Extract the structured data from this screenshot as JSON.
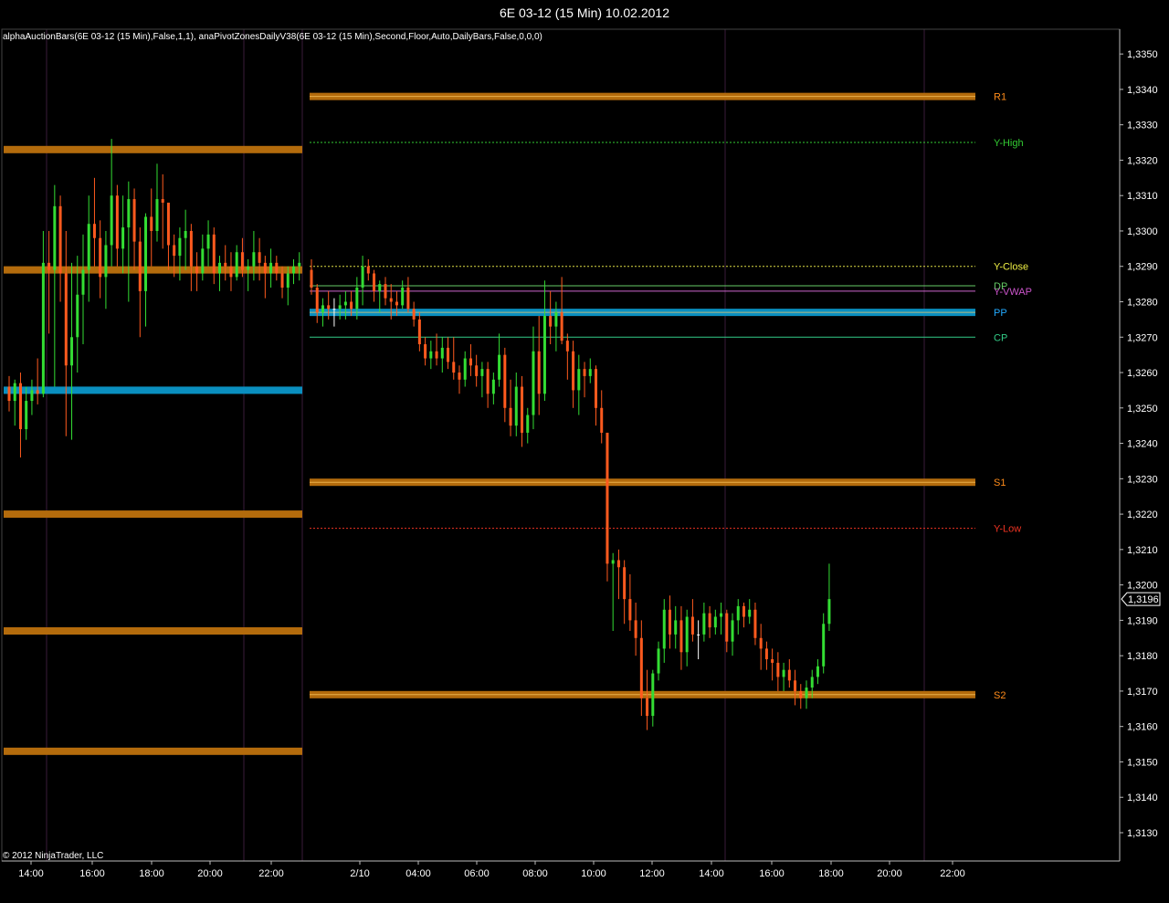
{
  "window": {
    "title": "6E 03-12 (15 Min)  10.02.2012"
  },
  "indicator_text": "alphaAuctionBars(6E 03-12 (15 Min),False,1,1),  anaPivotZonesDailyV38(6E 03-12 (15 Min),Second,Floor,Auto,DailyBars,False,0,0,0)",
  "copyright": "© 2012 NinjaTrader, LLC",
  "colors": {
    "background": "#000000",
    "up": "#33dd33",
    "down": "#ff5a1e",
    "neutral": "#ffffff",
    "zone_orange": "#b36b0c",
    "zone_blue": "#0a8fbf",
    "session_line": "#3a1d3a",
    "axis": "#bbbbbb"
  },
  "chart_data": {
    "type": "candlestick",
    "y_axis": {
      "ylim": [
        1.3122,
        1.3357
      ],
      "ticks": [
        "1,3350",
        "1,3340",
        "1,3330",
        "1,3320",
        "1,3310",
        "1,3300",
        "1,3290",
        "1,3280",
        "1,3270",
        "1,3260",
        "1,3250",
        "1,3240",
        "1,3230",
        "1,3220",
        "1,3210",
        "1,3200",
        "1,3190",
        "1,3180",
        "1,3170",
        "1,3160",
        "1,3150",
        "1,3140",
        "1,3130"
      ],
      "last_price_label": "1,3196",
      "last_price": 1.3196
    },
    "x_axis": {
      "ticks": [
        "14:00",
        "16:00",
        "18:00",
        "20:00",
        "22:00",
        "2/10",
        "04:00",
        "06:00",
        "08:00",
        "10:00",
        "12:00",
        "14:00",
        "16:00",
        "18:00",
        "20:00",
        "22:00"
      ]
    },
    "previous_day_zones": [
      {
        "level": 1.3323,
        "color": "orange"
      },
      {
        "level": 1.3289,
        "color": "orange"
      },
      {
        "level": 1.3255,
        "color": "blue"
      },
      {
        "level": 1.322,
        "color": "orange"
      },
      {
        "level": 1.3187,
        "color": "orange"
      },
      {
        "level": 1.3153,
        "color": "orange"
      }
    ],
    "pivot_levels": [
      {
        "name": "R1",
        "level": 1.3338,
        "style": "zone",
        "color": "#b36b0c",
        "label_color": "#ff8c1a"
      },
      {
        "name": "Y-High",
        "level": 1.3325,
        "style": "dotted",
        "color": "#33cc33",
        "label_color": "#33cc33"
      },
      {
        "name": "Y-Close",
        "level": 1.329,
        "style": "dotted",
        "color": "#dddd44",
        "label_color": "#eeee44"
      },
      {
        "name": "DP",
        "level": 1.32845,
        "style": "solid",
        "color": "#66cc66",
        "label_color": "#66cc66"
      },
      {
        "name": "Y-VWAP",
        "level": 1.3283,
        "style": "solid",
        "color": "#cc66cc",
        "label_color": "#cc55cc"
      },
      {
        "name": "PP",
        "level": 1.3277,
        "style": "zone",
        "color": "#0a8fbf",
        "label_color": "#22aaff"
      },
      {
        "name": "CP",
        "level": 1.327,
        "style": "solid",
        "color": "#33cc88",
        "label_color": "#33cc88"
      },
      {
        "name": "S1",
        "level": 1.3229,
        "style": "zone",
        "color": "#b36b0c",
        "label_color": "#ff8c1a"
      },
      {
        "name": "Y-Low",
        "level": 1.3216,
        "style": "dotted",
        "color": "#ee3322",
        "label_color": "#ee3322"
      },
      {
        "name": "S2",
        "level": 1.3169,
        "style": "zone",
        "color": "#b36b0c",
        "label_color": "#ff8c1a"
      }
    ],
    "candles": [
      [
        1.3256,
        1.3259,
        1.3249,
        1.3252
      ],
      [
        1.3252,
        1.3258,
        1.3245,
        1.3257
      ],
      [
        1.3257,
        1.326,
        1.3236,
        1.3244
      ],
      [
        1.3244,
        1.3256,
        1.3241,
        1.3252
      ],
      [
        1.3252,
        1.3258,
        1.3248,
        1.3255
      ],
      [
        1.3255,
        1.3264,
        1.3251,
        1.3254
      ],
      [
        1.3254,
        1.33,
        1.3253,
        1.3291
      ],
      [
        1.3291,
        1.33,
        1.3271,
        1.3289
      ],
      [
        1.3289,
        1.3313,
        1.3256,
        1.3307
      ],
      [
        1.3307,
        1.331,
        1.328,
        1.3288
      ],
      [
        1.3288,
        1.33,
        1.3242,
        1.3262
      ],
      [
        1.3262,
        1.3291,
        1.3241,
        1.327
      ],
      [
        1.327,
        1.3293,
        1.326,
        1.3282
      ],
      [
        1.3282,
        1.3299,
        1.3268,
        1.3289
      ],
      [
        1.3289,
        1.331,
        1.328,
        1.3302
      ],
      [
        1.3302,
        1.3315,
        1.329,
        1.3298
      ],
      [
        1.3298,
        1.3303,
        1.3281,
        1.3287
      ],
      [
        1.3287,
        1.33,
        1.3278,
        1.3296
      ],
      [
        1.3296,
        1.3326,
        1.329,
        1.331
      ],
      [
        1.331,
        1.3313,
        1.329,
        1.3295
      ],
      [
        1.3295,
        1.331,
        1.3288,
        1.3301
      ],
      [
        1.3301,
        1.3314,
        1.328,
        1.3309
      ],
      [
        1.3309,
        1.3312,
        1.3289,
        1.3297
      ],
      [
        1.3297,
        1.3301,
        1.327,
        1.3283
      ],
      [
        1.3283,
        1.3305,
        1.3273,
        1.3304
      ],
      [
        1.3304,
        1.3312,
        1.329,
        1.33
      ],
      [
        1.33,
        1.3319,
        1.3297,
        1.3309
      ],
      [
        1.3309,
        1.3316,
        1.3295,
        1.3308
      ],
      [
        1.3308,
        1.3307,
        1.3289,
        1.3296
      ],
      [
        1.3296,
        1.3299,
        1.3287,
        1.3293
      ],
      [
        1.3293,
        1.3301,
        1.3286,
        1.3298
      ],
      [
        1.3298,
        1.3306,
        1.3289,
        1.33
      ],
      [
        1.33,
        1.3302,
        1.3283,
        1.329
      ],
      [
        1.329,
        1.3294,
        1.3283,
        1.3288
      ],
      [
        1.3288,
        1.3299,
        1.3286,
        1.3295
      ],
      [
        1.3295,
        1.3303,
        1.329,
        1.3299
      ],
      [
        1.3299,
        1.3301,
        1.3285,
        1.3288
      ],
      [
        1.3288,
        1.3293,
        1.3283,
        1.3291
      ],
      [
        1.3291,
        1.3296,
        1.3286,
        1.329
      ],
      [
        1.329,
        1.3294,
        1.3283,
        1.3287
      ],
      [
        1.3287,
        1.3296,
        1.3286,
        1.3294
      ],
      [
        1.3294,
        1.3298,
        1.3287,
        1.3289
      ],
      [
        1.3289,
        1.3292,
        1.3283,
        1.329
      ],
      [
        1.329,
        1.33,
        1.3286,
        1.3294
      ],
      [
        1.3294,
        1.3298,
        1.3286,
        1.3291
      ],
      [
        1.3291,
        1.3293,
        1.3281,
        1.3288
      ],
      [
        1.3288,
        1.3295,
        1.3284,
        1.3291
      ],
      [
        1.3291,
        1.3293,
        1.3286,
        1.3288
      ],
      [
        1.3288,
        1.329,
        1.3281,
        1.3284
      ],
      [
        1.3284,
        1.329,
        1.3279,
        1.3288
      ],
      [
        1.3288,
        1.3292,
        1.3285,
        1.329
      ],
      [
        1.329,
        1.3294,
        1.3286,
        1.3291
      ],
      [
        1.3289,
        1.3292,
        1.3282,
        1.3284
      ],
      [
        1.3284,
        1.3285,
        1.3274,
        1.3277
      ],
      [
        1.3277,
        1.3281,
        1.3273,
        1.3279
      ],
      [
        1.3279,
        1.3283,
        1.3275,
        1.3278
      ],
      [
        1.3278,
        1.3281,
        1.3273,
        1.3278
      ],
      [
        1.3278,
        1.3282,
        1.3275,
        1.3279
      ],
      [
        1.3279,
        1.3283,
        1.3275,
        1.328
      ],
      [
        1.328,
        1.3283,
        1.3276,
        1.3278
      ],
      [
        1.3278,
        1.3287,
        1.3275,
        1.3284
      ],
      [
        1.3284,
        1.3293,
        1.3279,
        1.329
      ],
      [
        1.329,
        1.3292,
        1.3286,
        1.3288
      ],
      [
        1.3288,
        1.3289,
        1.328,
        1.3283
      ],
      [
        1.3283,
        1.3286,
        1.3277,
        1.3285
      ],
      [
        1.3285,
        1.3287,
        1.3279,
        1.3281
      ],
      [
        1.3281,
        1.3285,
        1.3275,
        1.328
      ],
      [
        1.328,
        1.3283,
        1.3276,
        1.3279
      ],
      [
        1.3279,
        1.3286,
        1.3278,
        1.3284
      ],
      [
        1.3284,
        1.3287,
        1.3277,
        1.3278
      ],
      [
        1.3278,
        1.328,
        1.3273,
        1.3275
      ],
      [
        1.3275,
        1.3277,
        1.3266,
        1.3268
      ],
      [
        1.3268,
        1.327,
        1.3262,
        1.3264
      ],
      [
        1.3264,
        1.3269,
        1.3261,
        1.3266
      ],
      [
        1.3266,
        1.3271,
        1.3262,
        1.3264
      ],
      [
        1.3264,
        1.327,
        1.326,
        1.3267
      ],
      [
        1.3267,
        1.327,
        1.3261,
        1.3263
      ],
      [
        1.3263,
        1.327,
        1.3258,
        1.326
      ],
      [
        1.326,
        1.3262,
        1.3254,
        1.3258
      ],
      [
        1.3258,
        1.3266,
        1.3256,
        1.3264
      ],
      [
        1.3264,
        1.3268,
        1.3259,
        1.3262
      ],
      [
        1.3262,
        1.3265,
        1.3256,
        1.3259
      ],
      [
        1.3259,
        1.3263,
        1.3253,
        1.3261
      ],
      [
        1.3261,
        1.3263,
        1.325,
        1.3254
      ],
      [
        1.3254,
        1.326,
        1.3251,
        1.3258
      ],
      [
        1.3258,
        1.3271,
        1.3256,
        1.3265
      ],
      [
        1.3265,
        1.3267,
        1.3246,
        1.325
      ],
      [
        1.325,
        1.3258,
        1.3242,
        1.3245
      ],
      [
        1.3245,
        1.326,
        1.3242,
        1.3256
      ],
      [
        1.3256,
        1.3259,
        1.3239,
        1.3243
      ],
      [
        1.3243,
        1.325,
        1.324,
        1.3248
      ],
      [
        1.3248,
        1.3273,
        1.3244,
        1.3266
      ],
      [
        1.3266,
        1.3276,
        1.3248,
        1.3254
      ],
      [
        1.3254,
        1.3286,
        1.3252,
        1.3276
      ],
      [
        1.3276,
        1.3283,
        1.3268,
        1.3273
      ],
      [
        1.3273,
        1.328,
        1.3266,
        1.3277
      ],
      [
        1.3277,
        1.3287,
        1.3268,
        1.3269
      ],
      [
        1.3269,
        1.3271,
        1.3258,
        1.3266
      ],
      [
        1.3266,
        1.3269,
        1.325,
        1.3255
      ],
      [
        1.3255,
        1.3265,
        1.3248,
        1.3261
      ],
      [
        1.3261,
        1.3263,
        1.3253,
        1.3259
      ],
      [
        1.3259,
        1.3264,
        1.3257,
        1.3261
      ],
      [
        1.3261,
        1.3262,
        1.3245,
        1.325
      ],
      [
        1.325,
        1.3255,
        1.324,
        1.3243
      ],
      [
        1.3243,
        1.323,
        1.3201,
        1.3206
      ],
      [
        1.3206,
        1.3209,
        1.3187,
        1.3207
      ],
      [
        1.3207,
        1.321,
        1.3196,
        1.3205
      ],
      [
        1.3205,
        1.3207,
        1.3189,
        1.3196
      ],
      [
        1.3196,
        1.3203,
        1.3187,
        1.319
      ],
      [
        1.319,
        1.3195,
        1.318,
        1.3185
      ],
      [
        1.3185,
        1.319,
        1.3163,
        1.3168
      ],
      [
        1.3168,
        1.3176,
        1.3159,
        1.3163
      ],
      [
        1.3163,
        1.3176,
        1.316,
        1.3175
      ],
      [
        1.3175,
        1.3184,
        1.3173,
        1.3182
      ],
      [
        1.3182,
        1.3196,
        1.3178,
        1.3193
      ],
      [
        1.3193,
        1.3197,
        1.3182,
        1.3186
      ],
      [
        1.3186,
        1.3194,
        1.3182,
        1.319
      ],
      [
        1.319,
        1.3194,
        1.3176,
        1.3181
      ],
      [
        1.3181,
        1.3193,
        1.3177,
        1.3191
      ],
      [
        1.3191,
        1.3196,
        1.3184,
        1.3186
      ],
      [
        1.3186,
        1.319,
        1.3179,
        1.3186
      ],
      [
        1.3186,
        1.3195,
        1.3184,
        1.3192
      ],
      [
        1.3192,
        1.3194,
        1.3185,
        1.3188
      ],
      [
        1.3188,
        1.3193,
        1.3186,
        1.3191
      ],
      [
        1.3191,
        1.3195,
        1.3186,
        1.3192
      ],
      [
        1.3192,
        1.3193,
        1.3181,
        1.3184
      ],
      [
        1.3184,
        1.3192,
        1.318,
        1.319
      ],
      [
        1.319,
        1.3196,
        1.3186,
        1.3194
      ],
      [
        1.3194,
        1.3195,
        1.3188,
        1.3191
      ],
      [
        1.3191,
        1.3196,
        1.3189,
        1.3193
      ],
      [
        1.3193,
        1.3195,
        1.3183,
        1.3185
      ],
      [
        1.3185,
        1.3189,
        1.3176,
        1.3182
      ],
      [
        1.3182,
        1.3184,
        1.3176,
        1.3179
      ],
      [
        1.3179,
        1.3182,
        1.3173,
        1.3178
      ],
      [
        1.3178,
        1.3181,
        1.317,
        1.3174
      ],
      [
        1.3174,
        1.3178,
        1.317,
        1.3176
      ],
      [
        1.3176,
        1.3179,
        1.3171,
        1.3173
      ],
      [
        1.3173,
        1.3176,
        1.3166,
        1.317
      ],
      [
        1.317,
        1.3172,
        1.3165,
        1.3168
      ],
      [
        1.3168,
        1.3173,
        1.3165,
        1.3171
      ],
      [
        1.3171,
        1.3176,
        1.3168,
        1.3174
      ],
      [
        1.3174,
        1.3179,
        1.3172,
        1.3177
      ],
      [
        1.3177,
        1.3192,
        1.3175,
        1.3189
      ],
      [
        1.3189,
        1.3206,
        1.3187,
        1.3196
      ]
    ]
  }
}
